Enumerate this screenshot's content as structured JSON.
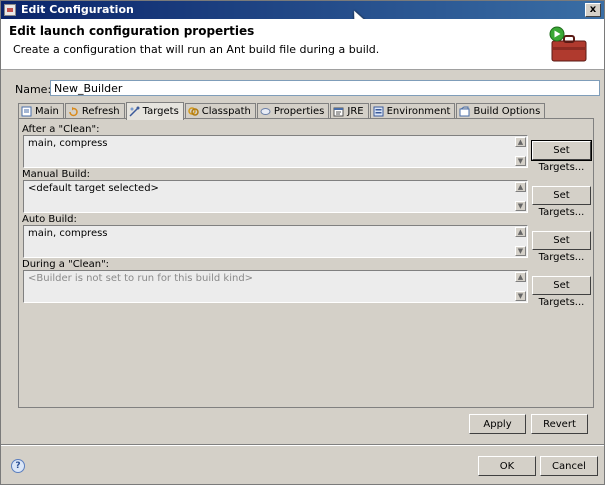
{
  "window": {
    "title": "Edit Configuration",
    "close_glyph": "x"
  },
  "header": {
    "title": "Edit launch configuration properties",
    "message": "Create a configuration that will run an Ant build file during a build.",
    "icon": "ant-toolbox-icon"
  },
  "name": {
    "label": "Name:",
    "value": "New_Builder"
  },
  "tabs": [
    {
      "label": "Main",
      "icon": "main-icon",
      "active": false
    },
    {
      "label": "Refresh",
      "icon": "refresh-icon",
      "active": false
    },
    {
      "label": "Targets",
      "icon": "targets-icon",
      "active": true
    },
    {
      "label": "Classpath",
      "icon": "classpath-icon",
      "active": false
    },
    {
      "label": "Properties",
      "icon": "properties-icon",
      "active": false
    },
    {
      "label": "JRE",
      "icon": "jre-icon",
      "active": false
    },
    {
      "label": "Environment",
      "icon": "environment-icon",
      "active": false
    },
    {
      "label": "Build Options",
      "icon": "build-options-icon",
      "active": false
    }
  ],
  "targets": {
    "after_clean": {
      "label": "After a \"Clean\":",
      "value": "main, compress",
      "button": "Set Targets..."
    },
    "manual_build": {
      "label": "Manual Build:",
      "value": "<default target selected>",
      "button": "Set Targets..."
    },
    "auto_build": {
      "label": "Auto Build:",
      "value": "main, compress",
      "button": "Set Targets..."
    },
    "during_clean": {
      "label": "During a \"Clean\":",
      "value": "<Builder is not set to run for this build kind>",
      "button": "Set Targets..."
    }
  },
  "actions": {
    "apply": "Apply",
    "revert": "Revert"
  },
  "footer": {
    "help": "?",
    "ok": "OK",
    "cancel": "Cancel"
  },
  "scroll": {
    "up": "▲",
    "down": "▼"
  }
}
